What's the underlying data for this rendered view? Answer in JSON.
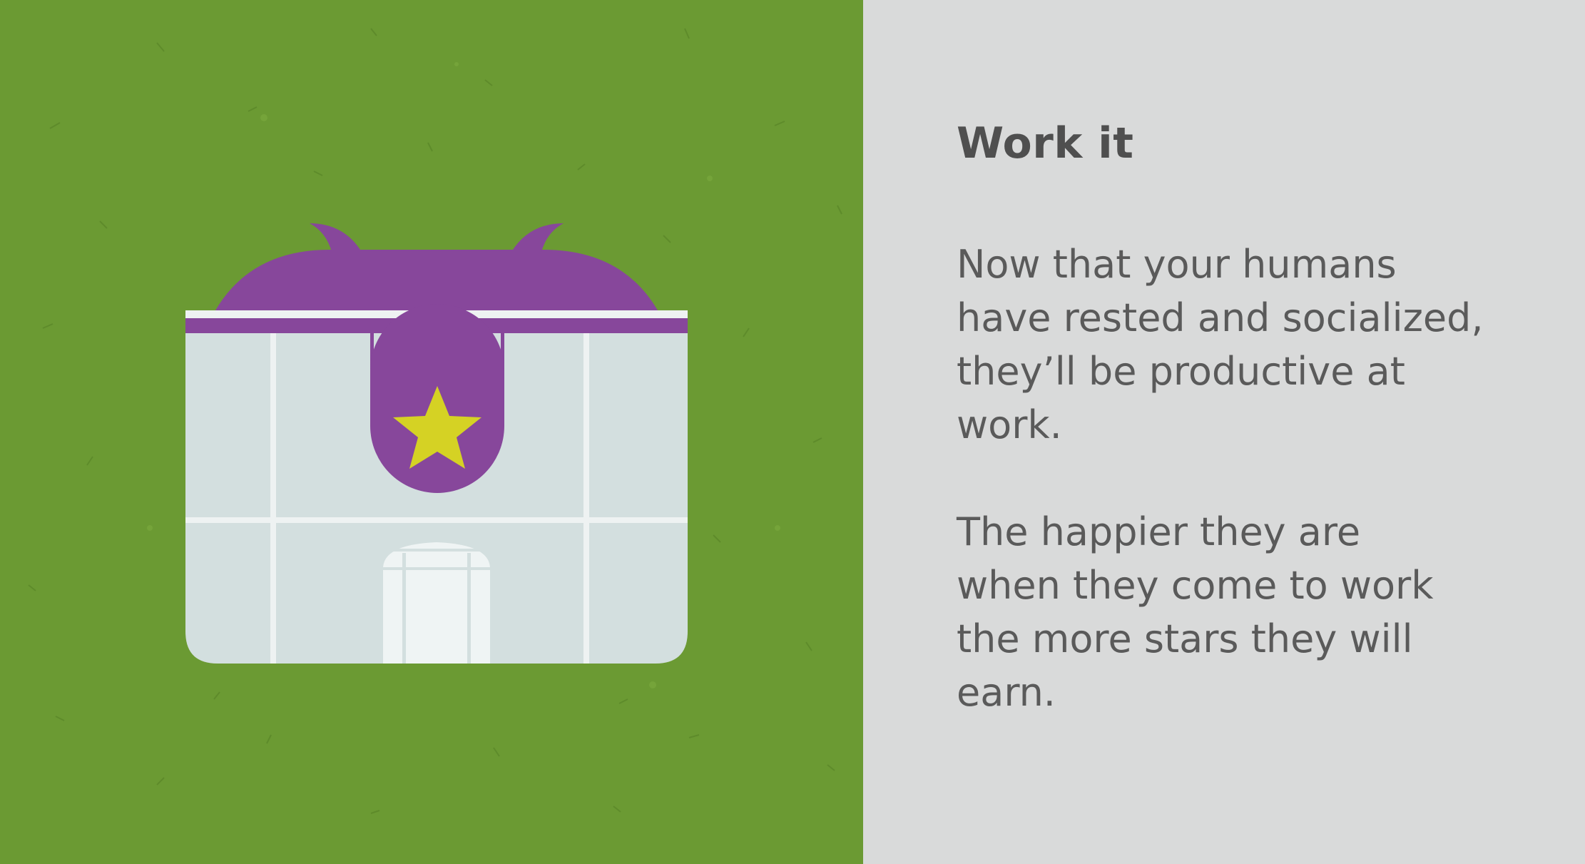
{
  "card": {
    "title": "Work it",
    "paragraphs": [
      "Now that your humans\nhave rested and socialized,\nthey’ll be productive at\nwork.",
      "The happier they are\nwhen they come to work\nthe more stars they will\nearn."
    ]
  },
  "illustration": {
    "subject": "office-building",
    "emblem": "star-icon",
    "colors": {
      "grass": "#6b9a33",
      "roof": "#87479b",
      "glass": "#d3dfdf",
      "frame": "#eef2f2",
      "star": "#d5d224",
      "panel": "#d9dada",
      "title_text": "#4f4f4f",
      "body_text": "#5a5a5a"
    }
  }
}
